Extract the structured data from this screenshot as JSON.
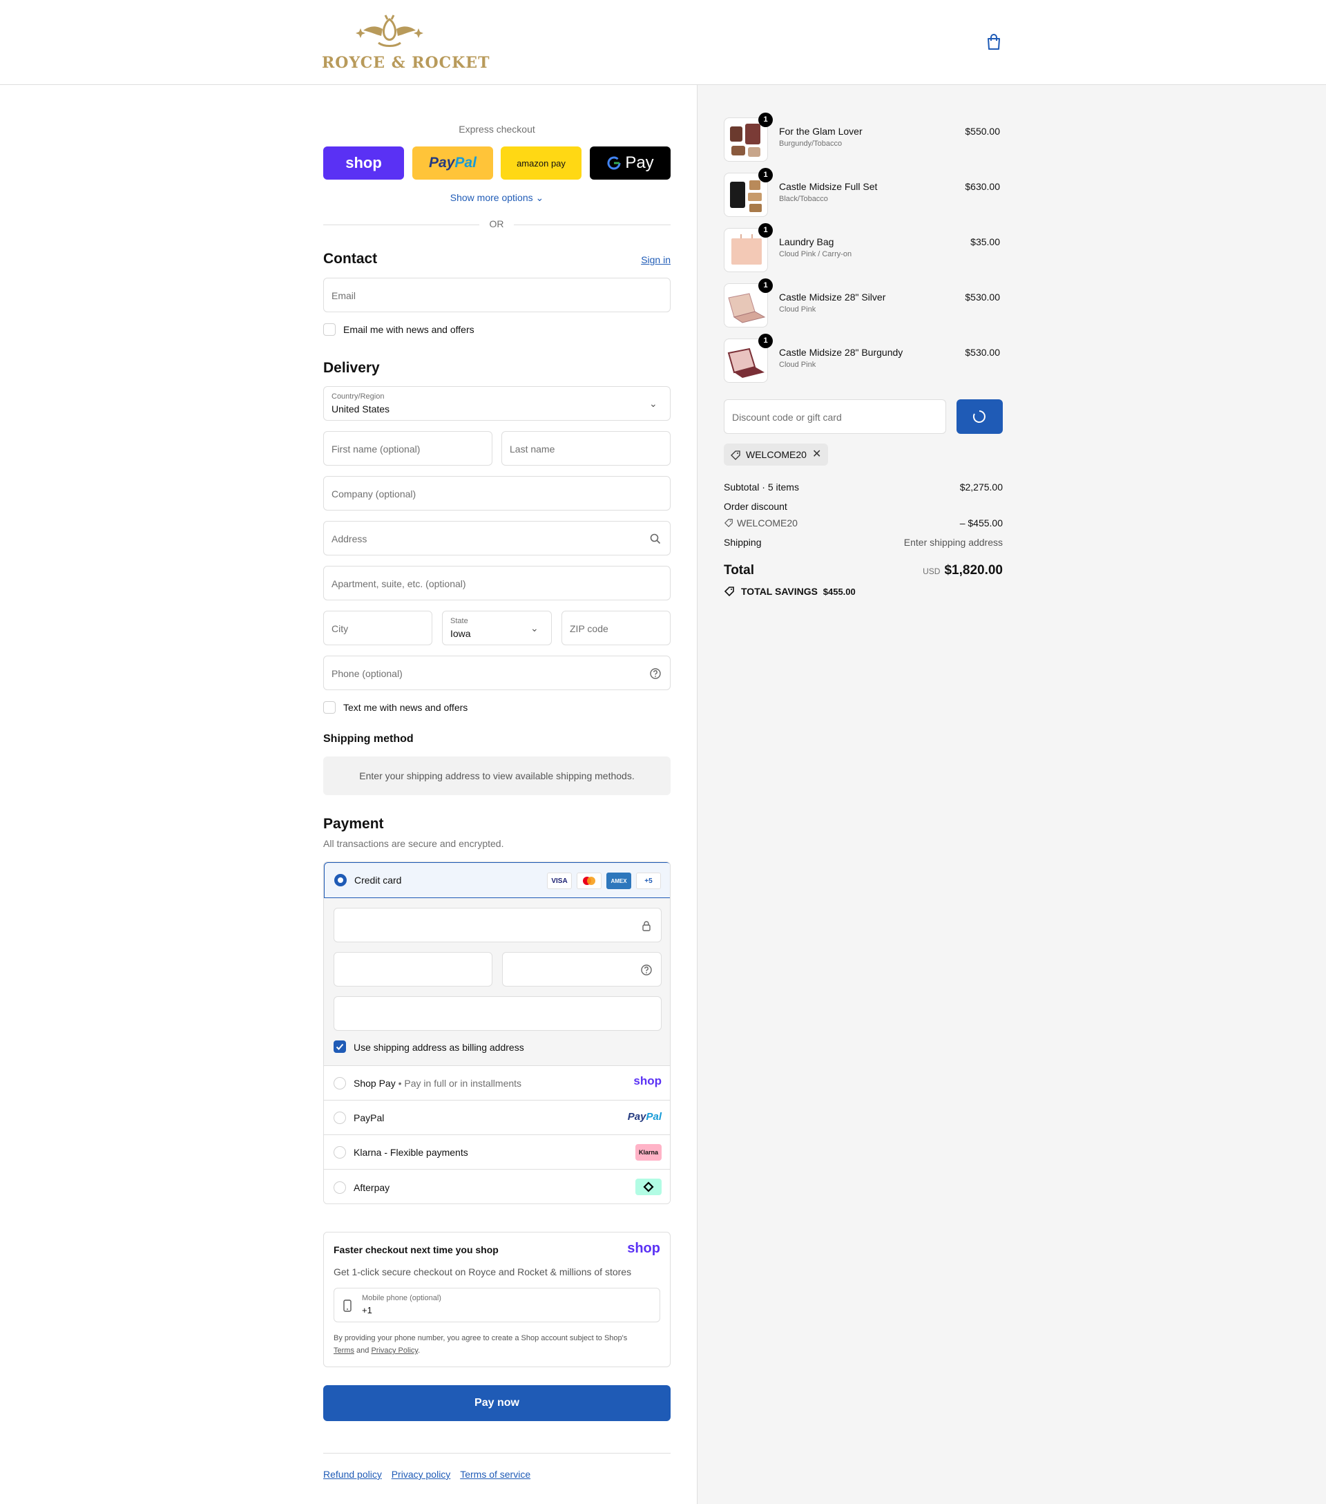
{
  "header": {
    "brand": "ROYCE & ROCKET",
    "cart_icon": "shopping-bag-icon"
  },
  "express": {
    "title": "Express checkout",
    "shop_label": "shop",
    "paypal_label_1": "Pay",
    "paypal_label_2": "Pal",
    "amazon_label": "amazon pay",
    "gpay_label": "Pay",
    "show_more": "Show more options",
    "or": "OR"
  },
  "contact": {
    "title": "Contact",
    "sign_in": "Sign in",
    "email_placeholder": "Email",
    "news_label": "Email me with news and offers"
  },
  "delivery": {
    "title": "Delivery",
    "country_label": "Country/Region",
    "country_value": "United States",
    "first_name": "First name (optional)",
    "last_name": "Last name",
    "company": "Company (optional)",
    "address": "Address",
    "apartment": "Apartment, suite, etc. (optional)",
    "city": "City",
    "state_label": "State",
    "state_value": "Iowa",
    "zip": "ZIP code",
    "phone": "Phone (optional)",
    "text_label": "Text me with news and offers"
  },
  "shipping": {
    "title": "Shipping method",
    "message": "Enter your shipping address to view available shipping methods."
  },
  "payment": {
    "title": "Payment",
    "subtitle": "All transactions are secure and encrypted.",
    "credit_card": "Credit card",
    "card_visa": "VISA",
    "card_amex": "AMEX",
    "card_more": "+5",
    "billing_label": "Use shipping address as billing address",
    "shop_pay": "Shop Pay",
    "shop_pay_sub": "Pay in full or in installments",
    "shop_pay_logo": "shop",
    "paypal": "PayPal",
    "paypal_logo_1": "Pay",
    "paypal_logo_2": "Pal",
    "klarna": "Klarna - Flexible payments",
    "klarna_logo": "Klarna",
    "afterpay": "Afterpay"
  },
  "shop_promo": {
    "title": "Faster checkout next time you shop",
    "logo": "shop",
    "desc": "Get 1-click secure checkout on Royce and Rocket & millions of stores",
    "phone_label": "Mobile phone (optional)",
    "phone_prefix": "+1",
    "legal_1": "By providing your phone number, you agree to create a Shop account subject to Shop's",
    "legal_terms": "Terms",
    "legal_and": "and",
    "legal_privacy": "Privacy Policy",
    "legal_end": "."
  },
  "pay_now": "Pay now",
  "footer": {
    "refund": "Refund policy",
    "privacy": "Privacy policy",
    "terms": "Terms of service"
  },
  "order": {
    "items": [
      {
        "name": "For the Glam Lover",
        "variant": "Burgundy/Tobacco",
        "price": "$550.00",
        "qty": "1"
      },
      {
        "name": "Castle Midsize Full Set",
        "variant": "Black/Tobacco",
        "price": "$630.00",
        "qty": "1"
      },
      {
        "name": "Laundry Bag",
        "variant": "Cloud Pink / Carry-on",
        "price": "$35.00",
        "qty": "1"
      },
      {
        "name": "Castle Midsize 28\" Silver",
        "variant": "Cloud Pink",
        "price": "$530.00",
        "qty": "1"
      },
      {
        "name": "Castle Midsize 28\" Burgundy",
        "variant": "Cloud Pink",
        "price": "$530.00",
        "qty": "1"
      }
    ],
    "discount_placeholder": "Discount code or gift card",
    "applied_code": "WELCOME20",
    "subtotal_label": "Subtotal · 5 items",
    "subtotal_value": "$2,275.00",
    "order_discount_label": "Order discount",
    "discount_code": "WELCOME20",
    "discount_value": "– $455.00",
    "shipping_label": "Shipping",
    "shipping_value": "Enter shipping address",
    "total_label": "Total",
    "currency": "USD",
    "total_value": "$1,820.00",
    "savings_label": "TOTAL SAVINGS",
    "savings_value": "$455.00"
  },
  "colors": {
    "accent": "#1f5bb6",
    "shop_purple": "#5a31f4",
    "brand_gold": "#b89a5a"
  }
}
